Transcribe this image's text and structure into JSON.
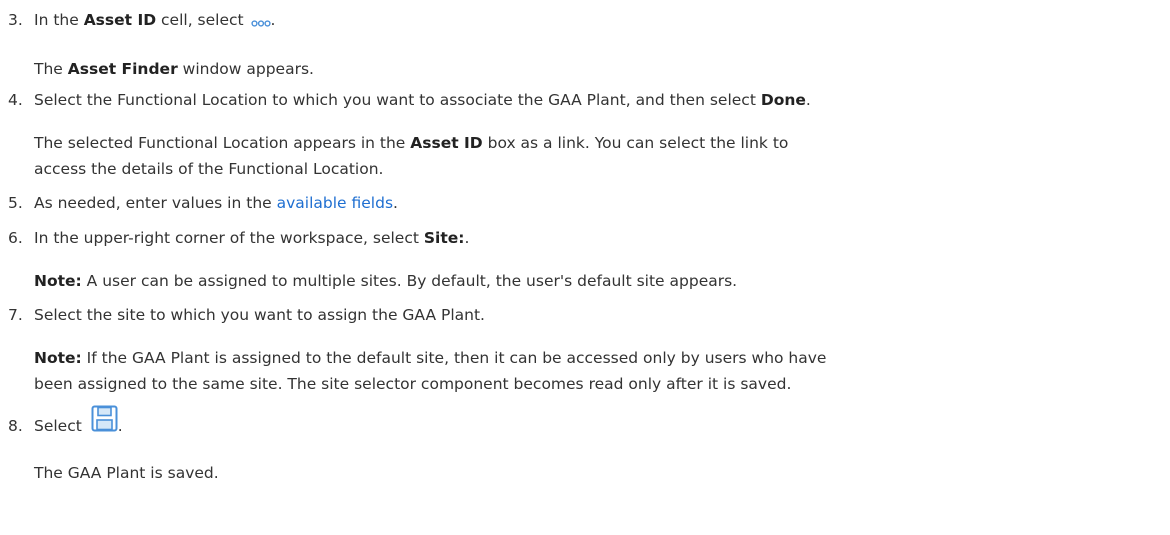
{
  "colors": {
    "text": "#333333",
    "link": "#1f6fd1",
    "icon": "#4a90d9"
  },
  "steps": [
    {
      "number": "3.",
      "pre": "In the ",
      "bold": "Asset ID",
      "mid": " cell, select ",
      "icon": "more-options-icon",
      "post": ".",
      "body": {
        "pre": "The ",
        "bold": "Asset Finder",
        "post": " window appears."
      }
    },
    {
      "number": "4.",
      "pre": "Select the Functional Location to which you want to associate the GAA Plant, and then select ",
      "bold": "Done",
      "post": ".",
      "body": {
        "line1_pre": "The selected Functional Location appears in the ",
        "line1_bold": "Asset ID",
        "line1_post": " box as a link. You can select the link to",
        "line2": "access the details of the Functional Location."
      }
    },
    {
      "number": "5.",
      "pre": "As needed, enter values in the ",
      "link": "available fields",
      "post": "."
    },
    {
      "number": "6.",
      "pre": "In the upper-right corner of the workspace, select ",
      "bold": "Site:",
      "post": ".",
      "note": {
        "label": "Note:",
        "text": " A user can be assigned to multiple sites. By default, the user's default site appears."
      }
    },
    {
      "number": "7.",
      "text": "Select the site to which you want to assign the GAA Plant.",
      "note": {
        "label": "Note:",
        "line1": " If the GAA Plant is assigned to the default site, then it can be accessed only by users who have",
        "line2": "been assigned to the same site. The site selector component becomes read only after it is saved."
      }
    },
    {
      "number": "8.",
      "pre": "Select ",
      "icon": "save-icon",
      "post": ".",
      "body": {
        "text": "The GAA Plant is saved."
      }
    }
  ]
}
